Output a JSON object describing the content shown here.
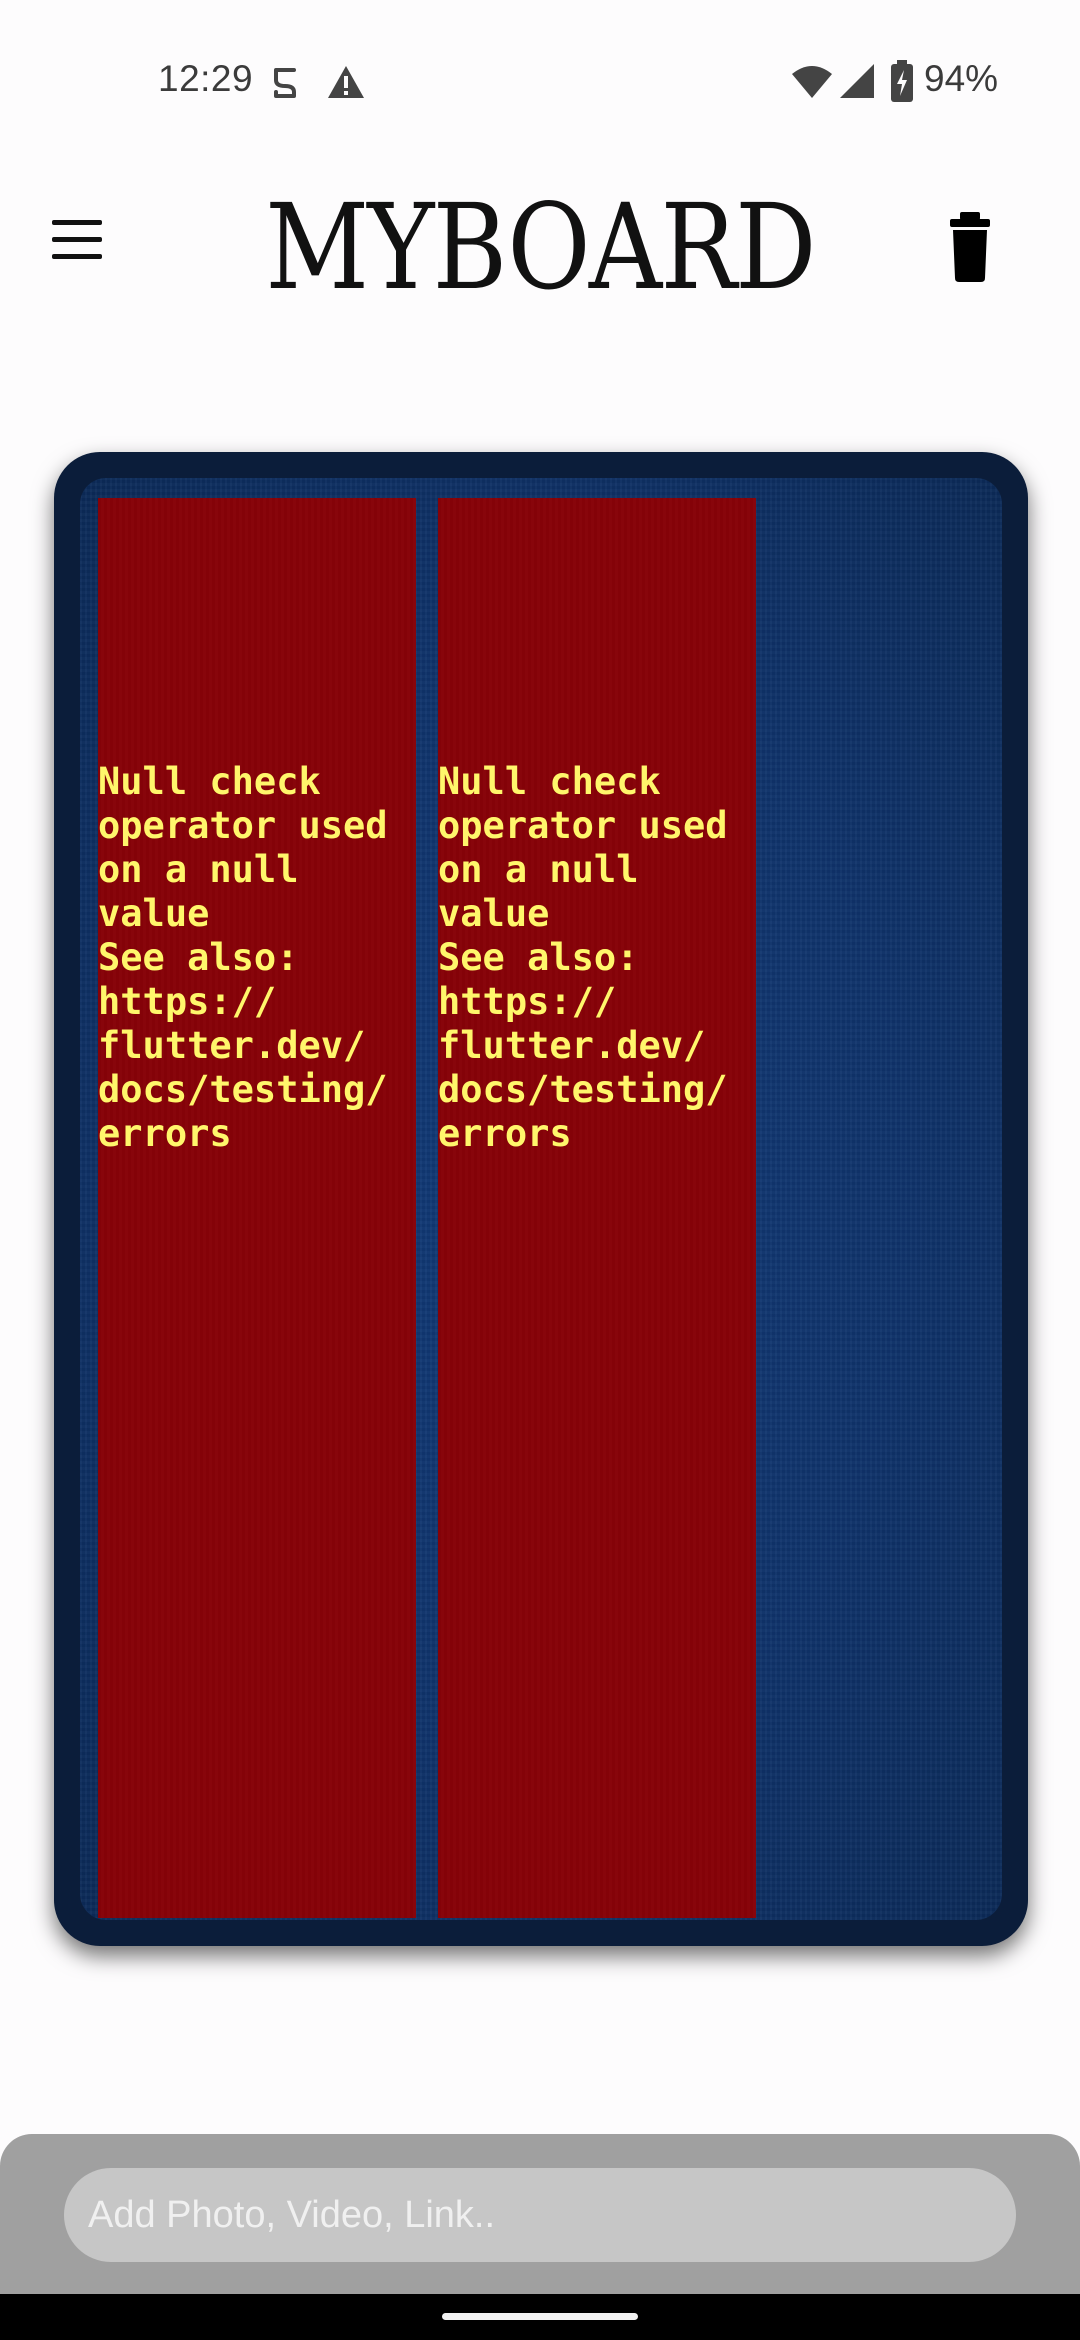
{
  "status_bar": {
    "time": "12:29",
    "battery_percent": "94%",
    "icons": [
      "subscription-icon",
      "warning-icon",
      "wifi-icon",
      "signal-icon",
      "battery-charging-icon"
    ]
  },
  "app_bar": {
    "title": "MYBOARD",
    "menu_icon": "hamburger-menu-icon",
    "delete_icon": "trash-icon"
  },
  "board": {
    "panels": [
      {
        "message": "Null check\noperator used\non a null\nvalue\nSee also:\nhttps://\nflutter.dev/\ndocs/testing/\nerrors"
      },
      {
        "message": "Null check\noperator used\non a null\nvalue\nSee also:\nhttps://\nflutter.dev/\ndocs/testing/\nerrors"
      }
    ],
    "colors": {
      "board_bg": "#0f336b",
      "error_bg": "#870208",
      "error_text": "#fff66b"
    }
  },
  "composer": {
    "placeholder": "Add Photo, Video, Link.."
  }
}
